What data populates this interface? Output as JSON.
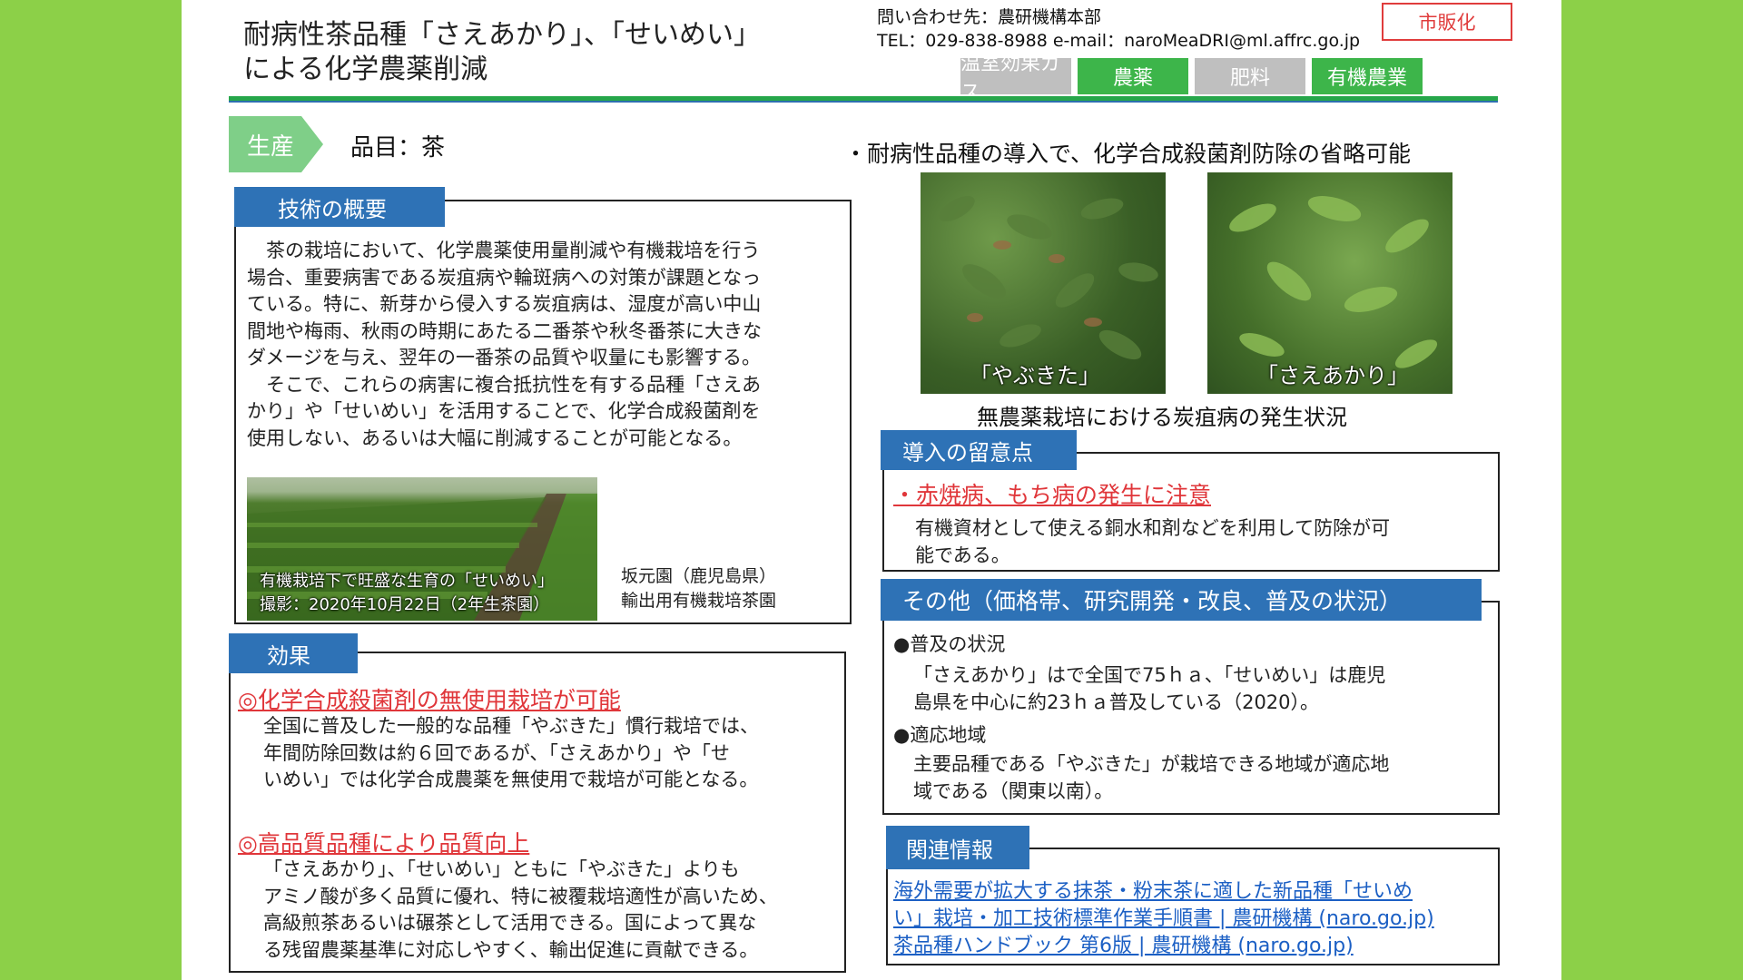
{
  "title": {
    "line1": "耐病性茶品種「さえあかり」、「せいめい」",
    "line2": "による化学農薬削減"
  },
  "contact": {
    "line1": "問い合わせ先：農研機構本部",
    "line2": "TEL：029-838-8988 e-mail：naroMeaDRI@ml.affrc.go.jp"
  },
  "badge": "市販化",
  "tabs": [
    {
      "label": "温室効果ガス",
      "color": "#bfbfbf"
    },
    {
      "label": "農薬",
      "color": "#3db54a"
    },
    {
      "label": "肥料",
      "color": "#bfbfbf"
    },
    {
      "label": "有機農業",
      "color": "#3db54a"
    }
  ],
  "category": {
    "label": "生産",
    "item": "品目：茶"
  },
  "overview": {
    "header": "技術の概要",
    "lines": [
      "　茶の栽培において、化学農薬使用量削減や有機栽培を行う",
      "場合、重要病害である炭疽病や輪斑病への対策が課題となっ",
      "ている。特に、新芽から侵入する炭疽病は、湿度が高い中山",
      "間地や梅雨、秋雨の時期にあたる二番茶や秋冬番茶に大きな",
      "ダメージを与え、翌年の一番茶の品質や収量にも影響する。",
      "　そこで、これらの病害に複合抵抗性を有する品種「さえあ",
      "かり」や「せいめい」を活用することで、化学合成殺菌剤を",
      "使用しない、あるいは大幅に削減することが可能となる。"
    ],
    "photo_caption1": "有機栽培下で旺盛な生育の「せいめい」",
    "photo_caption2": "撮影：2020年10月22日（2年生茶園）",
    "location1": "坂元園（鹿児島県）",
    "location2": "輸出用有機栽培茶園"
  },
  "effects": {
    "header": "効果",
    "items": [
      {
        "title": "◎化学合成殺菌剤の無使用栽培が可能",
        "lines": [
          "全国に普及した一般的な品種「やぶきた」慣行栽培では、",
          "年間防除回数は約６回であるが、「さえあかり」や「せ",
          "いめい」では化学合成農薬を無使用で栽培が可能となる。"
        ]
      },
      {
        "title": "◎高品質品種により品質向上",
        "lines": [
          "「さえあかり」、「せいめい」ともに「やぶきた」よりも",
          "アミノ酸が多く品質に優れ、特に被覆栽培適性が高いため、",
          "高級煎茶あるいは碾茶として活用できる。国によって異な",
          "る残留農薬基準に対応しやすく、輸出促進に貢献できる。"
        ]
      }
    ]
  },
  "right_heading": "・耐病性品種の導入で、化学合成殺菌剤防除の省略可能",
  "photos": {
    "left_label": "「やぶきた」",
    "right_label": "「さえあかり」",
    "caption": "無農薬栽培における炭疽病の発生状況"
  },
  "notes": {
    "header": "導入の留意点",
    "warning": "・赤焼病、もち病の発生に注意",
    "lines": [
      "有機資材として使える銅水和剤などを利用して防除が可",
      "能である。"
    ]
  },
  "other": {
    "header": "その他（価格帯、研究開発・改良、普及の状況）",
    "sections": [
      {
        "title": "●普及の状況",
        "lines": [
          "「さえあかり」はで全国で75ｈａ、「せいめい」は鹿児",
          "島県を中心に約23ｈａ普及している（2020）。"
        ]
      },
      {
        "title": "●適応地域",
        "lines": [
          "主要品種である「やぶきた」が栽培できる地域が適応地",
          "域である（関東以南）。"
        ]
      }
    ]
  },
  "related": {
    "header": "関連情報",
    "links": [
      "海外需要が拡大する抹茶・粉末茶に適した新品種「せいめ",
      "い」栽培・加工技術標準作業手順書 | 農研機構 (naro.go.jp)",
      "茶品種ハンドブック 第6版 | 農研機構 (naro.go.jp)"
    ]
  }
}
